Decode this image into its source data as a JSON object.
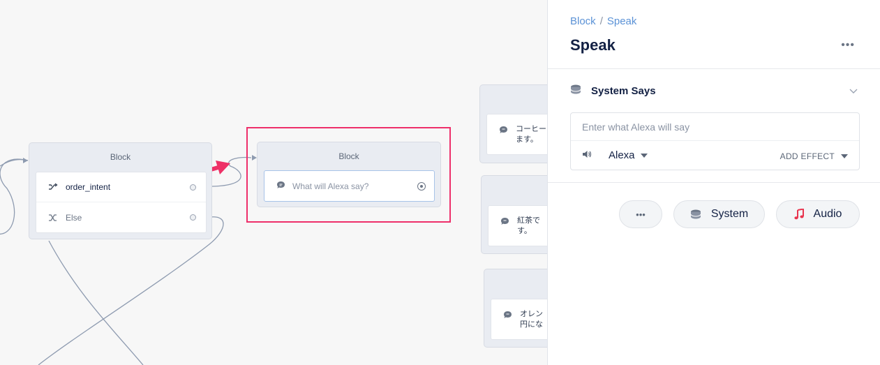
{
  "canvas": {
    "intent_block": {
      "title": "Block",
      "rows": [
        {
          "label": "order_intent",
          "icon": "shuffle-icon"
        },
        {
          "label": "Else",
          "icon": "shuffle-icon"
        }
      ]
    },
    "speak_block": {
      "title": "Block",
      "placeholder": "What will Alexa say?"
    },
    "right_blocks": [
      {
        "text_line1": "コーヒー",
        "text_line2": "ます。"
      },
      {
        "text_line1": "紅茶で",
        "text_line2": "す。"
      },
      {
        "text_line1": "オレン",
        "text_line2": "円にな"
      }
    ],
    "highlight_color": "#ee2f6a"
  },
  "panel": {
    "breadcrumb": {
      "parent": "Block",
      "separator": "/",
      "current": "Speak"
    },
    "title": "Speak",
    "more_label": "•••",
    "section": {
      "title": "System Says",
      "input_placeholder": "Enter what Alexa will say",
      "input_value": "",
      "voice": "Alexa",
      "effect_label": "ADD EFFECT"
    },
    "actions": {
      "more_label": "•••",
      "system_label": "System",
      "audio_label": "Audio"
    },
    "accent": "#5b92d6",
    "audio_icon_color": "#e8344e"
  }
}
